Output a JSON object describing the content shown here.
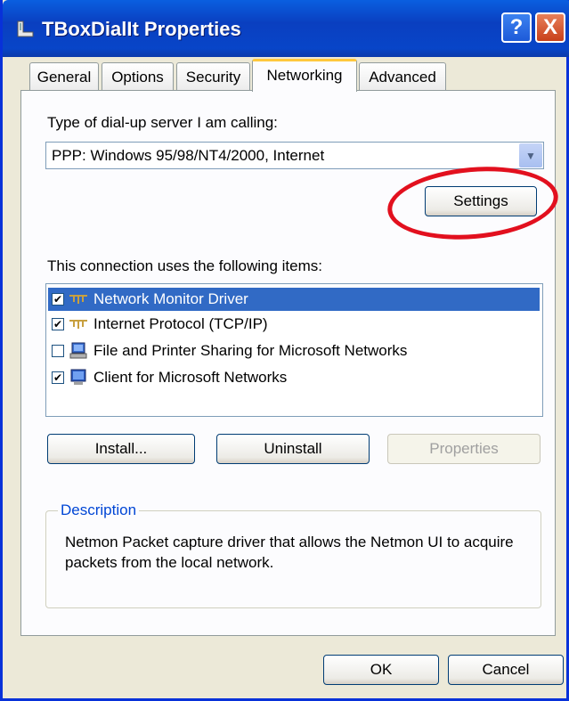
{
  "window": {
    "title": "TBoxDialIt Properties",
    "help_label": "?",
    "close_label": "X"
  },
  "tabs": [
    {
      "label": "General"
    },
    {
      "label": "Options"
    },
    {
      "label": "Security"
    },
    {
      "label": "Networking",
      "active": true
    },
    {
      "label": "Advanced"
    }
  ],
  "networking": {
    "server_type_label": "Type of dial-up server I am calling:",
    "server_type_value": "PPP: Windows 95/98/NT4/2000, Internet",
    "settings_button": "Settings",
    "items_label": "This connection uses the following items:",
    "items": [
      {
        "label": "Network Monitor Driver",
        "checked": true,
        "selected": true,
        "icon": "network-protocol-icon"
      },
      {
        "label": "Internet Protocol (TCP/IP)",
        "checked": true,
        "selected": false,
        "icon": "network-protocol-icon"
      },
      {
        "label": "File and Printer Sharing for Microsoft Networks",
        "checked": false,
        "selected": false,
        "icon": "computer-service-icon"
      },
      {
        "label": "Client for Microsoft Networks",
        "checked": true,
        "selected": false,
        "icon": "computer-client-icon"
      }
    ],
    "install_button": "Install...",
    "uninstall_button": "Uninstall",
    "properties_button": "Properties",
    "description_title": "Description",
    "description_text": "Netmon Packet capture driver that allows the Netmon UI to acquire packets from the local network."
  },
  "footer": {
    "ok_button": "OK",
    "cancel_button": "Cancel"
  },
  "colors": {
    "selection": "#316ac5",
    "annotation_circle": "#e2101e",
    "titlebar": "#0a3fc0"
  }
}
